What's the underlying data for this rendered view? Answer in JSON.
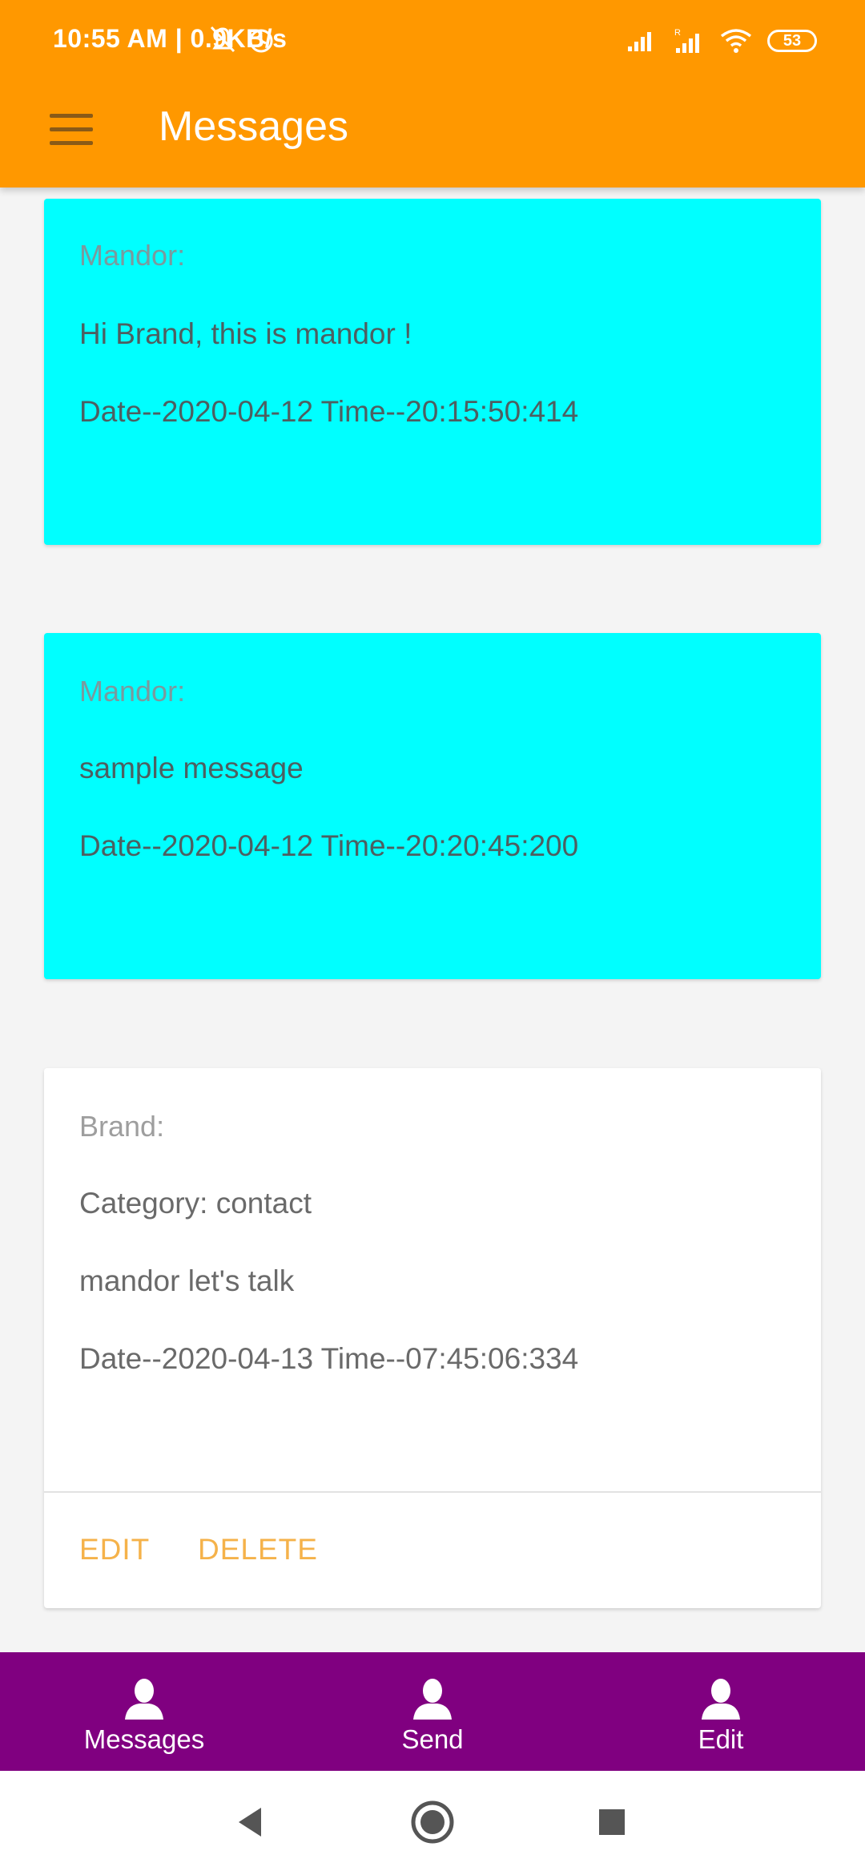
{
  "status_bar": {
    "time_speed": "10:55 AM | 0.9KB/s",
    "battery": "53"
  },
  "app_bar": {
    "title": "Messages"
  },
  "messages": [
    {
      "sender": "Mandor:",
      "text": "Hi Brand, this is mandor !",
      "datetime": "Date--2020-04-12  Time--20:15:50:414"
    },
    {
      "sender": "Mandor:",
      "text": "sample message",
      "datetime": "Date--2020-04-12  Time--20:20:45:200"
    },
    {
      "sender": "Brand:",
      "category": "Category: contact",
      "text": "mandor let's talk",
      "datetime": "Date--2020-04-13  Time--07:45:06:334",
      "edit_label": "EDIT",
      "delete_label": "DELETE"
    }
  ],
  "bottom_nav": {
    "items": [
      {
        "label": "Messages"
      },
      {
        "label": "Send"
      },
      {
        "label": "Edit"
      }
    ]
  },
  "colors": {
    "app_bar": "#ff9800",
    "received_card": "#00ffff",
    "sent_card": "#ffffff",
    "action_text": "#f5b24a",
    "bottom_nav": "#800080"
  }
}
